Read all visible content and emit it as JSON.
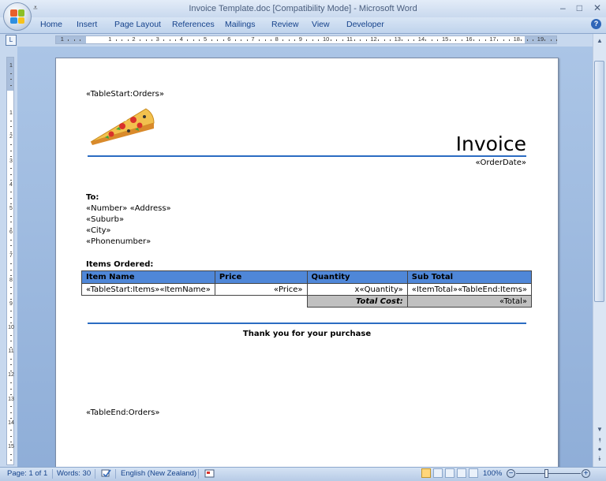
{
  "window": {
    "title": "Invoice Template.doc [Compatibility Mode] - Microsoft Word",
    "minimize": "–",
    "maximize": "□",
    "close": "✕"
  },
  "qat": {
    "customize": "⩡"
  },
  "ribbon": {
    "tabs": [
      "Home",
      "Insert",
      "Page Layout",
      "References",
      "Mailings",
      "Review",
      "View",
      "Developer"
    ],
    "help": "?"
  },
  "ruler": {
    "h_numbers": [
      "1",
      "1",
      "2",
      "3",
      "4",
      "5",
      "6",
      "7",
      "8",
      "9",
      "10",
      "11",
      "12",
      "13",
      "14",
      "15",
      "16",
      "17",
      "18",
      "19"
    ],
    "v_numbers": [
      "1",
      "1",
      "2",
      "3",
      "4",
      "5",
      "6",
      "7",
      "8",
      "9",
      "10",
      "11",
      "12",
      "13",
      "14",
      "15",
      "16"
    ],
    "toggle": "L"
  },
  "document": {
    "table_start_orders": "«TableStart:Orders»",
    "title": "Invoice",
    "order_date": "«OrderDate»",
    "to_label": "To:",
    "address_line": "«Number» «Address»",
    "suburb": "«Suburb»",
    "city": "«City»",
    "phone": "«Phonenumber»",
    "items_label": "Items Ordered:",
    "table": {
      "headers": [
        "Item Name",
        "Price",
        "Quantity",
        "Sub Total"
      ],
      "row": [
        "«TableStart:Items»«ItemName»",
        "«Price»",
        "x«Quantity»",
        "«ItemTotal»«TableEnd:Items»"
      ],
      "total_label": "Total Cost:",
      "total_value": "«Total»"
    },
    "thanks": "Thank you for your purchase",
    "table_end_orders": "«TableEnd:Orders»"
  },
  "statusbar": {
    "page": "Page: 1 of 1",
    "words": "Words: 30",
    "language": "English (New Zealand)",
    "zoom": "100%",
    "zoom_out": "−",
    "zoom_in": "+"
  },
  "colors": {
    "accent_rule": "#2b6cc2",
    "table_header": "#4f87d8",
    "total_gray": "#c0c0c0"
  }
}
